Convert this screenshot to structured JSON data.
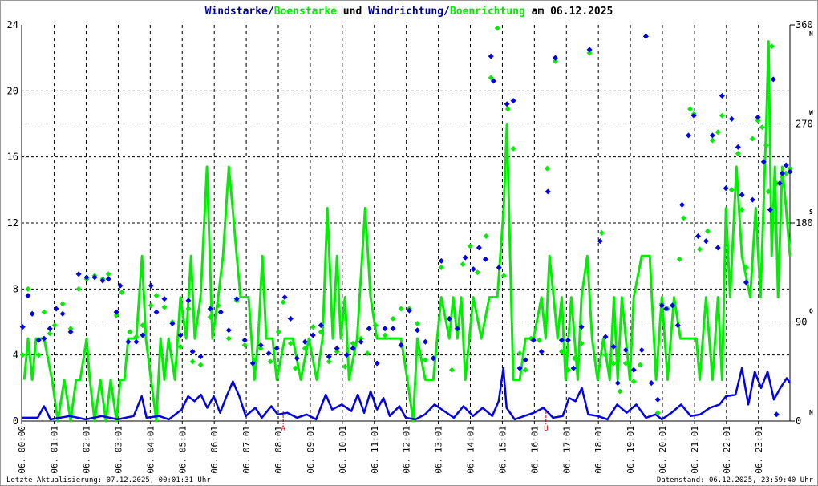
{
  "title": {
    "part1": "Windstarke/",
    "part2": "Boenstarke",
    "part3": " und ",
    "part4": "Windrichtung/",
    "part5": "Boenrichtung",
    "part6": " am 06.12.2025"
  },
  "footer": {
    "left": "Letzte Aktualisierung: 07.12.2025, 00:01:31 Uhr",
    "right": "Datenstand: 06.12.2025, 23:59:40 Uhr"
  },
  "colors": {
    "wind": "#0000ee",
    "gust": "#00ee00",
    "title_blue": "#000099",
    "marker": "#ee0000"
  },
  "chart_data": {
    "type": "line",
    "title": "Windstarke/Boenstarke und Windrichtung/Boenrichtung am 06.12.2025",
    "xlabel": "",
    "ylabel": "",
    "xlim_hours": [
      0,
      24
    ],
    "ylim_left": [
      0,
      24
    ],
    "ylim_right": [
      0,
      360
    ],
    "yticks_left": [
      "0",
      "4",
      "8",
      "12",
      "16",
      "20",
      "24"
    ],
    "yticks_right": [
      "0",
      "90",
      "180",
      "270",
      "360"
    ],
    "compass_labels": [
      {
        "deg": 360,
        "label": "N"
      },
      {
        "deg": 270,
        "label": "W"
      },
      {
        "deg": 180,
        "label": "S"
      },
      {
        "deg": 90,
        "label": "O"
      },
      {
        "deg": 0,
        "label": "N"
      }
    ],
    "xticks": [
      "06. 00:00",
      "06. 01:01",
      "06. 02:01",
      "06. 03:01",
      "06. 04:01",
      "06. 05:01",
      "06. 06:01",
      "06. 07:01",
      "06. 08:01",
      "06. 09:01",
      "06. 10:01",
      "06. 11:01",
      "06. 12:01",
      "06. 13:01",
      "06. 14:01",
      "06. 15:01",
      "06. 16:01",
      "06. 17:01",
      "06. 18:01",
      "06. 19:01",
      "06. 20:01",
      "06. 21:01",
      "06. 22:01",
      "06. 23:01"
    ],
    "xtick_hours": [
      0,
      1.017,
      2.017,
      3.017,
      4.017,
      5.017,
      6.017,
      7.017,
      8.017,
      9.017,
      10.017,
      11.017,
      12.017,
      13.017,
      14.017,
      15.017,
      16.017,
      17.017,
      18.017,
      19.017,
      20.017,
      21.017,
      22.017,
      23.017
    ],
    "sun_markers": [
      {
        "hour": 8.17,
        "label": "A"
      },
      {
        "hour": 16.38,
        "label": "U"
      }
    ],
    "grid": true,
    "series": [
      {
        "name": "Boenstarke",
        "kind": "line",
        "axis": "left",
        "hours": [
          0.08,
          0.2,
          0.33,
          0.45,
          0.7,
          0.95,
          1.13,
          1.33,
          1.53,
          1.7,
          1.83,
          2.03,
          2.13,
          2.28,
          2.46,
          2.63,
          2.78,
          2.96,
          3.08,
          3.21,
          3.33,
          3.58,
          3.76,
          3.88,
          4.04,
          4.21,
          4.34,
          4.46,
          4.59,
          4.79,
          4.96,
          5.14,
          5.29,
          5.41,
          5.59,
          5.79,
          5.96,
          6.14,
          6.29,
          6.47,
          6.59,
          6.72,
          6.84,
          7.09,
          7.27,
          7.39,
          7.52,
          7.64,
          7.84,
          7.97,
          8.22,
          8.47,
          8.72,
          8.97,
          9.22,
          9.4,
          9.55,
          9.72,
          9.85,
          9.97,
          10.1,
          10.23,
          10.48,
          10.73,
          10.9,
          11.1,
          11.35,
          11.6,
          11.85,
          12.05,
          12.23,
          12.36,
          12.61,
          12.86,
          12.98,
          13.11,
          13.36,
          13.48,
          13.61,
          13.73,
          13.86,
          14.11,
          14.36,
          14.61,
          14.86,
          15.06,
          15.16,
          15.26,
          15.36,
          15.56,
          15.74,
          15.99,
          16.24,
          16.37,
          16.49,
          16.62,
          16.74,
          16.87,
          16.99,
          17.17,
          17.37,
          17.49,
          17.67,
          17.82,
          17.99,
          18.17,
          18.37,
          18.5,
          18.62,
          18.75,
          19.0,
          19.12,
          19.37,
          19.62,
          19.82,
          20.0,
          20.18,
          20.38,
          20.58,
          20.83,
          21.08,
          21.18,
          21.38,
          21.58,
          21.75,
          21.88,
          22.0,
          22.13,
          22.33,
          22.5,
          22.76,
          22.93,
          23.08,
          23.26,
          23.33,
          23.43,
          23.53,
          23.63,
          23.76,
          23.88,
          24.0
        ],
        "values": [
          2.5,
          5,
          2.5,
          5,
          5,
          2.5,
          0,
          2.5,
          0,
          2.5,
          2.5,
          5,
          2.5,
          0,
          2.5,
          0,
          2.5,
          0,
          2.5,
          2.5,
          5,
          5,
          10,
          5,
          2.5,
          0,
          5,
          2.5,
          5,
          2.5,
          7.5,
          5,
          10,
          5,
          7.5,
          15.4,
          5,
          7.5,
          10,
          15.4,
          12.9,
          10,
          7.5,
          7.5,
          2.5,
          5,
          10,
          5,
          5,
          2.5,
          5,
          5,
          2.5,
          5,
          2.5,
          5,
          12.9,
          5,
          10,
          5,
          7.5,
          2.5,
          5,
          12.9,
          7.5,
          5,
          5,
          5,
          5,
          2.5,
          0,
          5,
          2.5,
          2.5,
          5,
          7.5,
          5,
          7.5,
          5,
          7.5,
          2.5,
          7.5,
          5,
          7.5,
          7.5,
          12.9,
          18,
          10,
          2.5,
          2.5,
          5,
          5,
          7.5,
          5,
          10,
          7.5,
          5,
          7.5,
          2.5,
          7.5,
          2.5,
          7.5,
          10,
          5,
          2.5,
          5,
          2.5,
          7.5,
          2.5,
          7.5,
          2.5,
          7.5,
          10,
          10,
          2.5,
          7.5,
          2.5,
          7.5,
          5,
          5,
          5,
          2.5,
          7.5,
          2.5,
          7.5,
          2.5,
          12.9,
          7.5,
          15.4,
          10,
          7.5,
          12.9,
          7.5,
          18,
          23,
          10,
          15.4,
          7.5,
          15.4,
          12.9,
          10
        ]
      },
      {
        "name": "Windstarke",
        "kind": "line",
        "axis": "left",
        "hours": [
          0,
          0.5,
          0.7,
          0.9,
          1.5,
          2,
          2.5,
          3,
          3.5,
          3.75,
          3.9,
          4.3,
          4.6,
          5,
          5.2,
          5.4,
          5.6,
          5.8,
          6,
          6.2,
          6.4,
          6.6,
          6.8,
          7,
          7.3,
          7.5,
          7.8,
          8,
          8.3,
          8.6,
          8.9,
          9.2,
          9.5,
          9.7,
          10,
          10.3,
          10.5,
          10.7,
          10.9,
          11.1,
          11.3,
          11.5,
          11.8,
          12,
          12.3,
          12.6,
          12.9,
          13.2,
          13.5,
          13.8,
          14.1,
          14.4,
          14.7,
          14.9,
          15.05,
          15.15,
          15.4,
          15.7,
          16,
          16.3,
          16.6,
          16.9,
          17.1,
          17.3,
          17.5,
          17.7,
          18,
          18.3,
          18.6,
          18.9,
          19.2,
          19.5,
          19.8,
          20,
          20.3,
          20.6,
          20.9,
          21.2,
          21.5,
          21.8,
          22,
          22.3,
          22.5,
          22.7,
          22.9,
          23.1,
          23.3,
          23.5,
          23.7,
          23.9,
          24
        ],
        "values": [
          0.2,
          0.2,
          0.9,
          0.1,
          0.3,
          0.1,
          0.3,
          0.1,
          0.3,
          1.5,
          0.2,
          0.3,
          0.1,
          0.7,
          1.5,
          1.2,
          1.6,
          0.8,
          1.5,
          0.5,
          1.5,
          2.4,
          1.5,
          0.3,
          0.8,
          0.2,
          0.9,
          0.4,
          0.5,
          0.2,
          0.4,
          0.1,
          1.6,
          0.7,
          1.0,
          0.6,
          1.6,
          0.5,
          1.8,
          0.7,
          1.4,
          0.3,
          0.9,
          0.2,
          0.1,
          0.4,
          1.0,
          0.6,
          0.2,
          0.9,
          0.3,
          0.8,
          0.3,
          1.2,
          3.2,
          0.8,
          0.1,
          0.3,
          0.5,
          0.8,
          0.2,
          0.3,
          1.4,
          1.2,
          2.0,
          0.4,
          0.3,
          0.1,
          1.0,
          0.5,
          1.0,
          0.2,
          0.4,
          0.1,
          0.5,
          1.0,
          0.3,
          0.4,
          0.8,
          1.0,
          1.5,
          1.6,
          3.2,
          1.0,
          3.0,
          2.0,
          3.0,
          1.3,
          2.0,
          2.6,
          2.3
        ]
      },
      {
        "name": "Boenrichtung",
        "kind": "scatter",
        "axis": "right",
        "hours": [
          0.03,
          0.2,
          0.33,
          0.53,
          0.7,
          0.88,
          1.03,
          1.28,
          1.53,
          1.78,
          2.03,
          2.28,
          2.53,
          2.71,
          2.96,
          3.13,
          3.38,
          3.58,
          3.78,
          4.04,
          4.21,
          4.46,
          4.71,
          4.96,
          5.21,
          5.34,
          5.59,
          5.89,
          6.14,
          6.47,
          6.72,
          6.97,
          7.29,
          7.47,
          7.77,
          8.02,
          8.17,
          8.4,
          8.55,
          8.85,
          9.1,
          9.35,
          9.6,
          9.85,
          10.1,
          10.35,
          10.6,
          10.8,
          11.05,
          11.35,
          11.6,
          11.85,
          12.11,
          12.36,
          12.61,
          12.86,
          13.11,
          13.44,
          13.61,
          13.78,
          14.01,
          14.24,
          14.51,
          14.66,
          14.86,
          15.06,
          15.19,
          15.36,
          15.56,
          15.74,
          15.91,
          16.17,
          16.42,
          16.67,
          16.87,
          17.07,
          17.27,
          17.49,
          17.74,
          18.12,
          18.24,
          18.49,
          18.69,
          18.87,
          19.12,
          19.32,
          19.5,
          19.67,
          19.87,
          20.0,
          20.18,
          20.38,
          20.55,
          20.68,
          20.88,
          21.0,
          21.18,
          21.43,
          21.58,
          21.75,
          21.88,
          22.0,
          22.18,
          22.38,
          22.5,
          22.63,
          22.83,
          23.0,
          23.13,
          23.26,
          23.33,
          23.43,
          23.58,
          23.76,
          23.88,
          24.0
        ],
        "values": [
          60,
          120,
          97.5,
          60,
          99,
          79.5,
          87,
          106.5,
          84,
          120,
          129,
          132,
          129,
          133.5,
          96,
          117,
          81,
          76.5,
          87,
          105,
          114,
          103.5,
          90,
          67.5,
          102,
          54,
          51,
          94.5,
          105,
          75,
          109.5,
          69,
          55.5,
          66,
          54,
          81,
          108,
          70.5,
          48,
          66,
          85.5,
          81,
          54,
          63,
          49.5,
          70.5,
          75,
          61.5,
          87,
          78,
          93,
          102,
          102,
          88.5,
          55.5,
          57,
          139.5,
          46.5,
          84,
          142.5,
          159,
          135,
          168,
          312,
          357,
          132,
          283.5,
          247.5,
          61.5,
          46.5,
          75,
          73.5,
          229.5,
          327,
          63,
          46.5,
          57,
          70.5,
          334.5,
          171,
          60,
          52.5,
          27,
          52.5,
          36,
          51,
          349.5,
          34.5,
          7.5,
          106.5,
          102,
          106.5,
          147,
          184.5,
          283.5,
          279,
          156,
          172.5,
          255,
          262.5,
          277.5,
          211.5,
          210,
          243,
          192,
          139.5,
          256.5,
          273,
          267,
          250.5,
          208.5,
          340.5,
          216,
          222,
          225,
          229.5
        ]
      },
      {
        "name": "Windrichtung",
        "kind": "scatter",
        "axis": "right",
        "hours": [
          0.03,
          0.2,
          0.33,
          0.53,
          0.7,
          0.88,
          1.08,
          1.28,
          1.53,
          1.78,
          2.03,
          2.28,
          2.53,
          2.71,
          2.96,
          3.08,
          3.33,
          3.58,
          3.78,
          4.04,
          4.21,
          4.46,
          4.71,
          4.96,
          5.21,
          5.34,
          5.59,
          5.89,
          6.22,
          6.47,
          6.72,
          6.97,
          7.22,
          7.47,
          7.72,
          7.97,
          8.22,
          8.4,
          8.6,
          8.85,
          9.1,
          9.35,
          9.6,
          9.85,
          10.15,
          10.35,
          10.6,
          10.85,
          11.1,
          11.35,
          11.6,
          11.85,
          12.11,
          12.36,
          12.61,
          12.86,
          13.11,
          13.36,
          13.61,
          13.86,
          14.11,
          14.29,
          14.49,
          14.66,
          14.74,
          14.91,
          15.16,
          15.36,
          15.56,
          15.74,
          15.99,
          16.24,
          16.44,
          16.67,
          16.87,
          17.07,
          17.24,
          17.49,
          17.74,
          18.07,
          18.24,
          18.49,
          18.62,
          18.87,
          19.12,
          19.37,
          19.5,
          19.67,
          19.87,
          20.0,
          20.13,
          20.33,
          20.5,
          20.63,
          20.83,
          21.0,
          21.13,
          21.38,
          21.58,
          21.75,
          21.88,
          22.0,
          22.18,
          22.38,
          22.5,
          22.63,
          22.83,
          23.0,
          23.18,
          23.38,
          23.48,
          23.58,
          23.68,
          23.76,
          23.88,
          24.0
        ],
        "values": [
          85.5,
          114,
          97.5,
          73.5,
          75,
          84,
          102,
          97.5,
          81,
          133.5,
          130.5,
          130.5,
          127.5,
          129,
          99,
          123,
          72,
          72,
          78,
          123,
          99,
          111,
          88.5,
          78,
          109.5,
          63,
          58.5,
          102,
          99,
          82.5,
          111,
          73.5,
          52.5,
          69,
          61.5,
          66,
          112.5,
          93,
          57,
          72,
          78,
          87,
          58.5,
          66,
          60,
          66,
          72,
          84,
          52.5,
          84,
          84,
          69,
          100.5,
          82.5,
          72,
          57,
          145.5,
          93,
          84,
          148.5,
          138,
          157.5,
          147,
          331.5,
          309,
          139.5,
          288,
          291,
          48,
          55.5,
          73.5,
          63,
          208.5,
          330,
          73.5,
          73.5,
          48,
          85.5,
          337.5,
          163.5,
          76.5,
          67.5,
          34.5,
          64.5,
          46.5,
          64.5,
          349.5,
          34.5,
          19.5,
          105,
          102,
          105,
          87,
          196.5,
          259.5,
          277.5,
          168,
          163.5,
          259.5,
          157.5,
          295.5,
          211.5,
          274.5,
          249,
          205.5,
          126,
          201,
          276,
          235.5,
          192,
          310.5,
          6,
          216,
          225,
          232.5,
          226.5
        ]
      }
    ]
  }
}
